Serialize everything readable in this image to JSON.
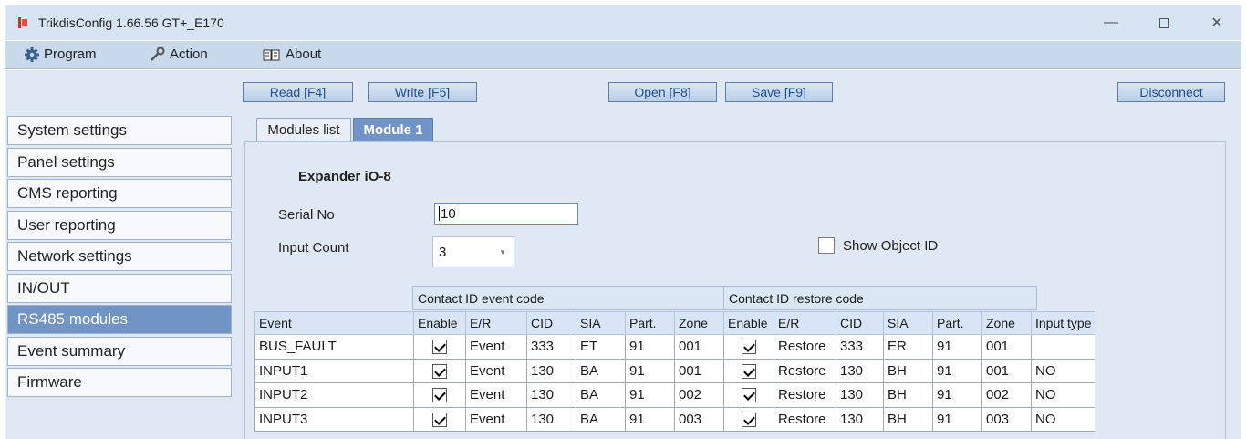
{
  "window": {
    "title": "TrikdisConfig 1.66.56   GT+_E170"
  },
  "menu": {
    "program": {
      "label": "Program",
      "icon": "gear-icon"
    },
    "action": {
      "label": "Action",
      "icon": "wrench-icon"
    },
    "about": {
      "label": "About",
      "icon": "book-icon"
    }
  },
  "toolbar": {
    "read": "Read [F4]",
    "write": "Write [F5]",
    "open": "Open [F8]",
    "save": "Save [F9]",
    "disconnect": "Disconnect"
  },
  "sidebar": {
    "items": [
      {
        "label": "System settings"
      },
      {
        "label": "Panel settings"
      },
      {
        "label": "CMS reporting"
      },
      {
        "label": "User reporting"
      },
      {
        "label": "Network settings"
      },
      {
        "label": "IN/OUT"
      },
      {
        "label": "RS485 modules",
        "active": true
      },
      {
        "label": "Event summary"
      },
      {
        "label": "Firmware"
      }
    ]
  },
  "tabs": {
    "modules_list": "Modules list",
    "module1": "Module 1"
  },
  "module": {
    "heading": "Expander iO-8",
    "serial_label": "Serial No",
    "serial_value": "10",
    "input_count_label": "Input Count",
    "input_count_value": "3",
    "show_object_id_label": "Show Object ID",
    "show_object_id_checked": false
  },
  "grid": {
    "group_event": "Contact ID event code",
    "group_restore": "Contact ID restore code",
    "columns": [
      "Event",
      "Enable",
      "E/R",
      "CID",
      "SIA",
      "Part.",
      "Zone",
      "Enable",
      "E/R",
      "CID",
      "SIA",
      "Part.",
      "Zone",
      "Input type"
    ],
    "rows": [
      {
        "event": "BUS_FAULT",
        "e_enable": true,
        "e_er": "Event",
        "e_cid": "333",
        "e_sia": "ET",
        "e_part": "91",
        "e_zone": "001",
        "r_enable": true,
        "r_er": "Restore",
        "r_cid": "333",
        "r_sia": "ER",
        "r_part": "91",
        "r_zone": "001",
        "input_type": ""
      },
      {
        "event": "INPUT1",
        "e_enable": true,
        "e_er": "Event",
        "e_cid": "130",
        "e_sia": "BA",
        "e_part": "91",
        "e_zone": "001",
        "r_enable": true,
        "r_er": "Restore",
        "r_cid": "130",
        "r_sia": "BH",
        "r_part": "91",
        "r_zone": "001",
        "input_type": "NO"
      },
      {
        "event": "INPUT2",
        "e_enable": true,
        "e_er": "Event",
        "e_cid": "130",
        "e_sia": "BA",
        "e_part": "91",
        "e_zone": "002",
        "r_enable": true,
        "r_er": "Restore",
        "r_cid": "130",
        "r_sia": "BH",
        "r_part": "91",
        "r_zone": "002",
        "input_type": "NO"
      },
      {
        "event": "INPUT3",
        "e_enable": true,
        "e_er": "Event",
        "e_cid": "130",
        "e_sia": "BA",
        "e_part": "91",
        "e_zone": "003",
        "r_enable": true,
        "r_er": "Restore",
        "r_cid": "130",
        "r_sia": "BH",
        "r_part": "91",
        "r_zone": "003",
        "input_type": "NO"
      }
    ]
  },
  "colors": {
    "accent": "#6f94c5",
    "titlebar": "#d6e4f3",
    "menubar": "#c9d9ec",
    "button_text": "#1f4e8c"
  }
}
